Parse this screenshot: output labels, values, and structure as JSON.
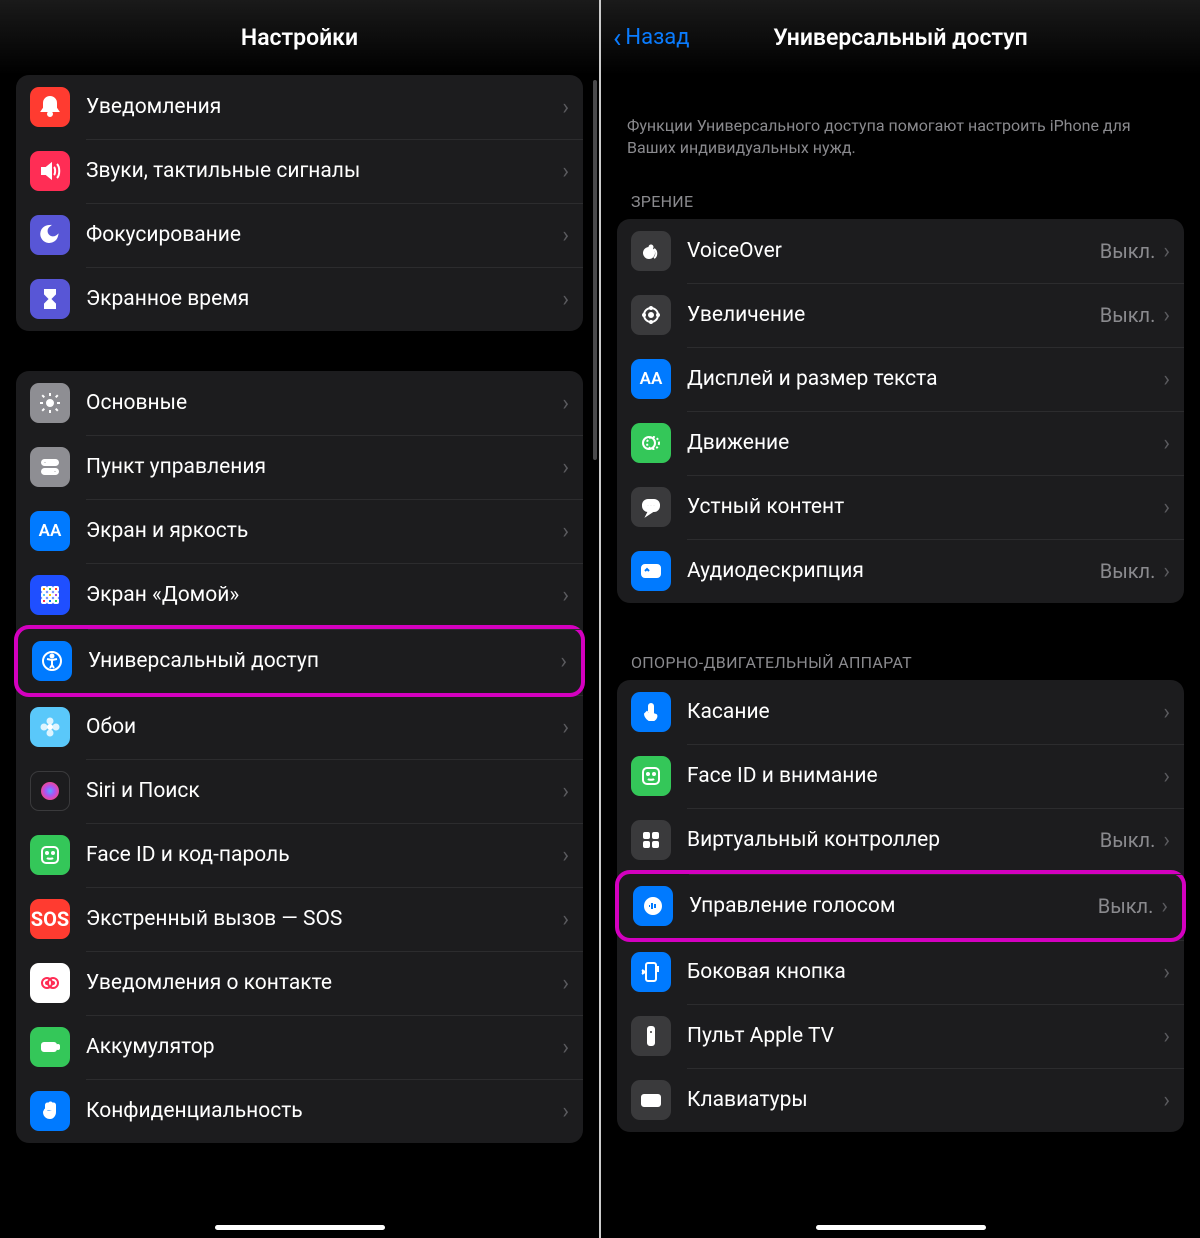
{
  "left": {
    "title": "Настройки",
    "group1": [
      {
        "id": "notifications",
        "label": "Уведомления",
        "icon": "bell",
        "bg": "ic-red"
      },
      {
        "id": "sounds",
        "label": "Звуки, тактильные сигналы",
        "icon": "sound",
        "bg": "ic-pink"
      },
      {
        "id": "focus",
        "label": "Фокусирование",
        "icon": "moon",
        "bg": "ic-indigo"
      },
      {
        "id": "screentime",
        "label": "Экранное время",
        "icon": "hourglass",
        "bg": "ic-indigo"
      }
    ],
    "group2": [
      {
        "id": "general",
        "label": "Основные",
        "icon": "gear",
        "bg": "ic-gray"
      },
      {
        "id": "control",
        "label": "Пункт управления",
        "icon": "switches",
        "bg": "ic-gray"
      },
      {
        "id": "display",
        "label": "Экран и яркость",
        "icon": "aa",
        "bg": "ic-blue"
      },
      {
        "id": "home",
        "label": "Экран «Домой»",
        "icon": "grid",
        "bg": "ic-home"
      },
      {
        "id": "accessibility",
        "label": "Универсальный доступ",
        "icon": "access",
        "bg": "ic-blue",
        "highlight": true
      },
      {
        "id": "wallpaper",
        "label": "Обои",
        "icon": "flower",
        "bg": "ic-teal"
      },
      {
        "id": "siri",
        "label": "Siri и Поиск",
        "icon": "siri",
        "bg": "ic-black"
      },
      {
        "id": "faceid",
        "label": "Face ID и код-пароль",
        "icon": "face",
        "bg": "ic-green"
      },
      {
        "id": "sos",
        "label": "Экстренный вызов — SOS",
        "icon": "sos",
        "bg": "ic-sos"
      },
      {
        "id": "exposure",
        "label": "Уведомления о контакте",
        "icon": "exposure",
        "bg": "ic-white"
      },
      {
        "id": "battery",
        "label": "Аккумулятор",
        "icon": "battery",
        "bg": "ic-green"
      },
      {
        "id": "privacy",
        "label": "Конфиденциальность",
        "icon": "hand",
        "bg": "ic-blue"
      }
    ]
  },
  "right": {
    "back": "Назад",
    "title": "Универсальный доступ",
    "desc": "Функции Универсального доступа помогают настроить iPhone для Ваших индивидуальных нужд.",
    "sec1_header": "ЗРЕНИЕ",
    "sec1": [
      {
        "id": "voiceover",
        "label": "VoiceOver",
        "value": "Выкл.",
        "icon": "voiceover",
        "bg": "ic-dgray"
      },
      {
        "id": "zoom",
        "label": "Увеличение",
        "value": "Выкл.",
        "icon": "zoom",
        "bg": "ic-dgray"
      },
      {
        "id": "textsize",
        "label": "Дисплей и размер текста",
        "icon": "aa",
        "bg": "ic-blue"
      },
      {
        "id": "motion",
        "label": "Движение",
        "icon": "motion",
        "bg": "ic-green"
      },
      {
        "id": "spoken",
        "label": "Устный контент",
        "icon": "bubble",
        "bg": "ic-dgray"
      },
      {
        "id": "audio-desc",
        "label": "Аудиодескрипция",
        "value": "Выкл.",
        "icon": "ad",
        "bg": "ic-blue"
      }
    ],
    "sec2_header": "ОПОРНО-ДВИГАТЕЛЬНЫЙ АППАРАТ",
    "sec2": [
      {
        "id": "touch",
        "label": "Касание",
        "icon": "touch",
        "bg": "ic-blue"
      },
      {
        "id": "face-attention",
        "label": "Face ID и внимание",
        "icon": "face",
        "bg": "ic-green"
      },
      {
        "id": "switch-control",
        "label": "Виртуальный контроллер",
        "value": "Выкл.",
        "icon": "grid4",
        "bg": "ic-dgray"
      },
      {
        "id": "voice-control",
        "label": "Управление голосом",
        "value": "Выкл.",
        "icon": "voice",
        "bg": "ic-blue",
        "highlight": true
      },
      {
        "id": "side-button",
        "label": "Боковая кнопка",
        "icon": "side",
        "bg": "ic-blue"
      },
      {
        "id": "apple-tv",
        "label": "Пульт Apple TV",
        "icon": "remote",
        "bg": "ic-dgray"
      },
      {
        "id": "keyboards",
        "label": "Клавиатуры",
        "icon": "keyboard",
        "bg": "ic-dgray"
      }
    ]
  }
}
